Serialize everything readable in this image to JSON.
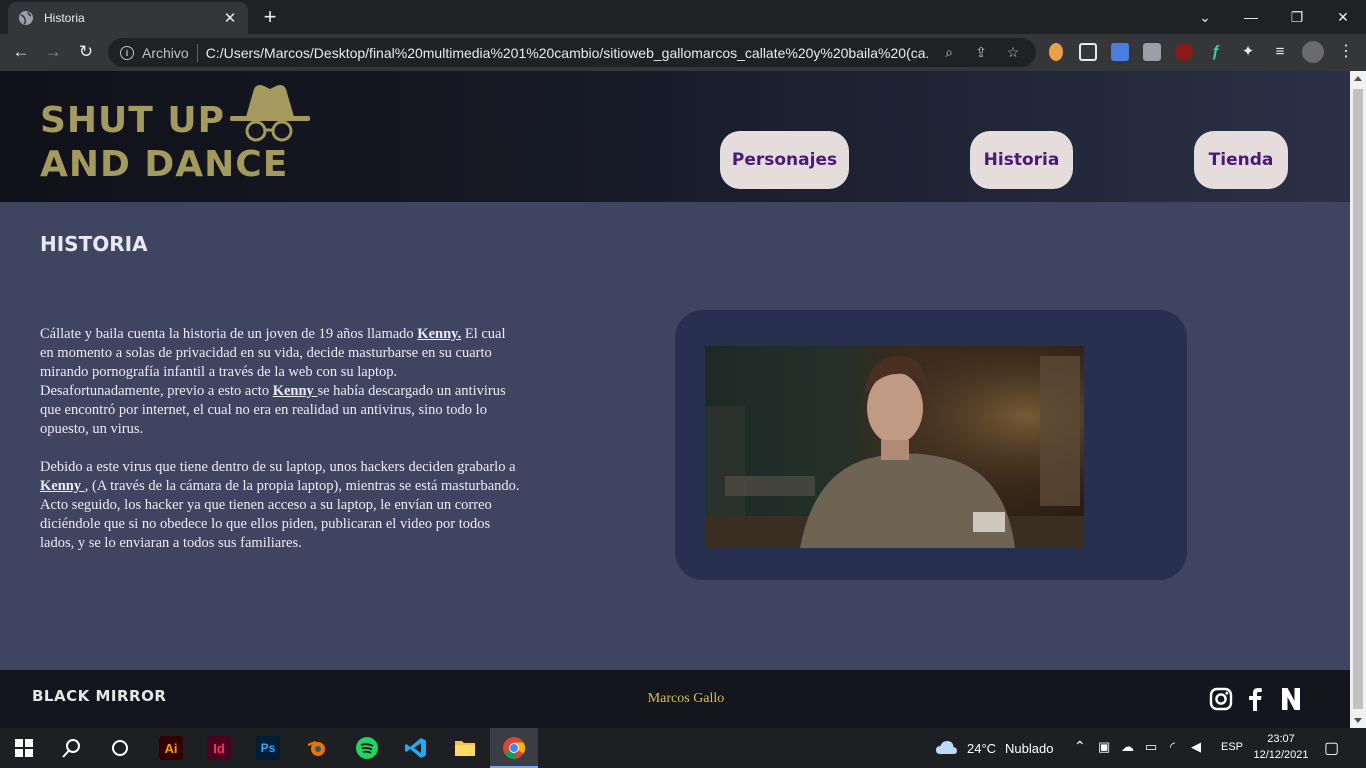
{
  "browser": {
    "tab_title": "Historia",
    "address_scheme": "Archivo",
    "address_url": "C:/Users/Marcos/Desktop/final%20multimedia%201%20cambio/sitioweb_gallomarcos_callate%20y%20baila%20(ca..."
  },
  "site": {
    "logo_line1": "SHUT UP",
    "logo_line2": "AND DANCE",
    "nav": [
      "Personajes",
      "Historia",
      "Tienda"
    ],
    "page_title": "HISTORIA",
    "story": {
      "p1_a": "Cállate y baila cuenta la historia de un joven de 19 años llamado ",
      "p1_name1": "Kenny.",
      "p1_b": " El cual en momento a solas de privacidad en su vida, decide masturbarse en su cuarto mirando pornografía infantil a través de la web con su laptop. Desafortunadamente, previo a esto acto ",
      "p1_name2": "Kenny ",
      "p1_c": "se había descargado un antivirus que encontró por internet, el cual no era en realidad un antivirus, sino todo lo opuesto, un virus.",
      "p2_a": "Debido a este virus que tiene dentro de su laptop, unos hackers deciden grabarlo a ",
      "p2_name": "Kenny ",
      "p2_b": ", (A través de la cámara de la propia laptop), mientras se está masturbando. Acto seguido, los hacker ya que tienen acceso a su laptop, le envían un correo diciéndole que si no obedece lo que ellos piden, publicaran el video por todos lados, y se lo enviaran a todos sus familiares."
    },
    "footer_brand": "BLACK MIRROR",
    "footer_author": "Marcos Gallo",
    "social_icons": [
      "instagram-icon",
      "facebook-icon",
      "netflix-icon"
    ]
  },
  "taskbar": {
    "weather_temp": "24°C",
    "weather_text": "Nublado",
    "language": "ESP",
    "time": "23:07",
    "date": "12/12/2021"
  },
  "colors": {
    "page_bg": "#3f4560",
    "logo_gold": "#a49a5e",
    "nav_pill": "#e5dcdc",
    "nav_text": "#4a1a7a",
    "author_gold": "#d7c04a"
  }
}
